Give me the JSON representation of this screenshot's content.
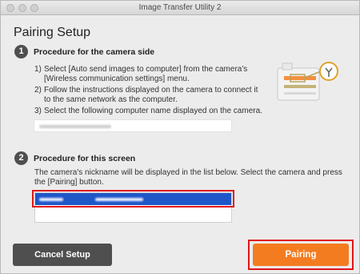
{
  "window": {
    "title": "Image Transfer Utility 2"
  },
  "page": {
    "heading": "Pairing Setup"
  },
  "step1": {
    "number": "1",
    "title": "Procedure for the camera side",
    "items": [
      {
        "n": "1)",
        "text": "Select [Auto send images to computer] from the camera's [Wireless communication settings] menu."
      },
      {
        "n": "2)",
        "text": "Follow the instructions displayed on the camera to connect it to the same network as the computer."
      },
      {
        "n": "3)",
        "text": "Select the following computer name displayed on the camera."
      }
    ],
    "computer_name": ""
  },
  "step2": {
    "number": "2",
    "title": "Procedure for this screen",
    "description": "The camera's nickname will be displayed in the list below. Select the camera and press the [Pairing] button.",
    "camera_list": [
      {
        "selected": true
      }
    ]
  },
  "buttons": {
    "cancel": "Cancel Setup",
    "pairing": "Pairing"
  },
  "colors": {
    "accent": "#f47c20",
    "highlight": "#e0151a",
    "selection": "#1f57c9",
    "dark_button": "#4f4f4f"
  }
}
